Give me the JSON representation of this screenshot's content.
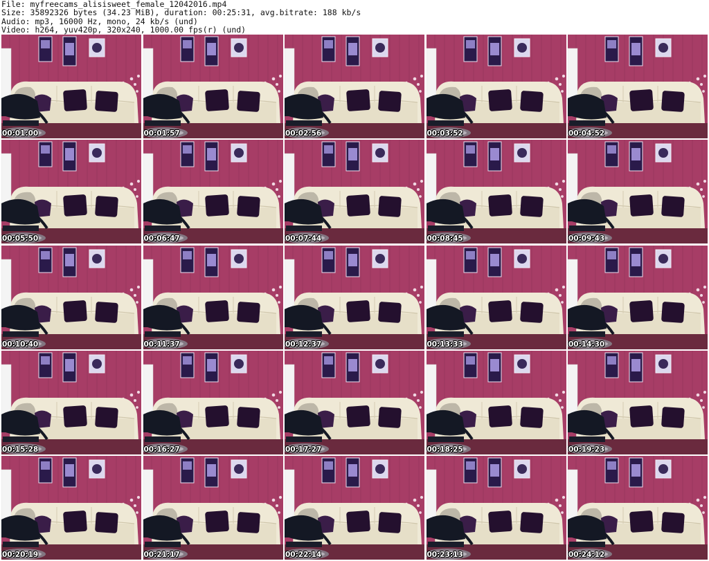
{
  "header": {
    "file": "File: myfreecams_alisisweet_female_12042016.mp4",
    "size": "Size: 35892326 bytes (34.23 MiB), duration: 00:25:31, avg.bitrate: 188 kb/s",
    "audio": "Audio: mp3, 16000 Hz, mono, 24 kb/s (und)",
    "video": "Video: h264, yuv420p, 320x240, 1000.00 fps(r) (und)"
  },
  "colors": {
    "wall": "#a73d66",
    "sofa": "#efe9d6",
    "pillow": "#24102e",
    "chair": "#141824",
    "lamp": "#f4f4f4"
  },
  "thumbnails": [
    {
      "timestamp": "00:01:00"
    },
    {
      "timestamp": "00:01:57"
    },
    {
      "timestamp": "00:02:56"
    },
    {
      "timestamp": "00:03:52"
    },
    {
      "timestamp": "00:04:52"
    },
    {
      "timestamp": "00:05:50"
    },
    {
      "timestamp": "00:06:47"
    },
    {
      "timestamp": "00:07:44"
    },
    {
      "timestamp": "00:08:45"
    },
    {
      "timestamp": "00:09:43"
    },
    {
      "timestamp": "00:10:40"
    },
    {
      "timestamp": "00:11:37"
    },
    {
      "timestamp": "00:12:37"
    },
    {
      "timestamp": "00:13:33"
    },
    {
      "timestamp": "00:14:30"
    },
    {
      "timestamp": "00:15:28"
    },
    {
      "timestamp": "00:16:27"
    },
    {
      "timestamp": "00:17:27"
    },
    {
      "timestamp": "00:18:25"
    },
    {
      "timestamp": "00:19:23"
    },
    {
      "timestamp": "00:20:19"
    },
    {
      "timestamp": "00:21:17"
    },
    {
      "timestamp": "00:22:14"
    },
    {
      "timestamp": "00:23:13"
    },
    {
      "timestamp": "00:24:12"
    }
  ]
}
